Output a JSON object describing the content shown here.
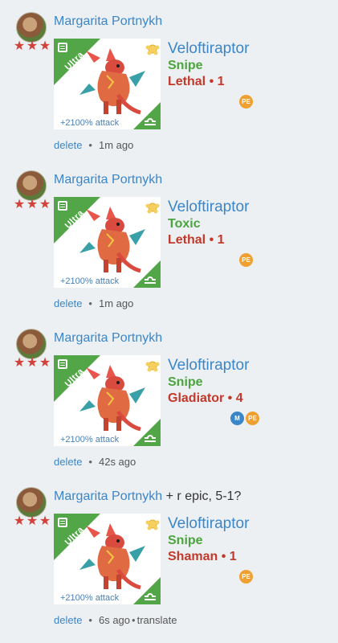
{
  "posts": [
    {
      "author": "Margarita Portnykh",
      "message": "",
      "rating_stars": 3,
      "card": {
        "rarity": "Ultra",
        "attack": "+2100% attack",
        "element": "libra-icon"
      },
      "dragon": {
        "name": "Veloftiraptor",
        "trait": "Snipe",
        "role": "Lethal • 1"
      },
      "badges": [
        {
          "label": "PE",
          "color": "#f0a030"
        }
      ],
      "actions": {
        "delete": "delete",
        "separator": "•",
        "time": "1m ago",
        "translate": ""
      }
    },
    {
      "author": "Margarita Portnykh",
      "message": "",
      "rating_stars": 3,
      "card": {
        "rarity": "Ultra",
        "attack": "+2100% attack",
        "element": "libra-icon"
      },
      "dragon": {
        "name": "Veloftiraptor",
        "trait": "Toxic",
        "role": "Lethal • 1"
      },
      "badges": [
        {
          "label": "PE",
          "color": "#f0a030"
        }
      ],
      "actions": {
        "delete": "delete",
        "separator": "•",
        "time": "1m ago",
        "translate": ""
      }
    },
    {
      "author": "Margarita Portnykh",
      "message": "",
      "rating_stars": 3,
      "card": {
        "rarity": "Ultra",
        "attack": "+2100% attack",
        "element": "libra-icon"
      },
      "dragon": {
        "name": "Veloftiraptor",
        "trait": "Snipe",
        "role": "Gladiator • 4"
      },
      "badges": [
        {
          "label": "M",
          "color": "#3a86c8"
        },
        {
          "label": "PE",
          "color": "#f0a030"
        }
      ],
      "actions": {
        "delete": "delete",
        "separator": "•",
        "time": "42s ago",
        "translate": ""
      }
    },
    {
      "author": "Margarita Portnykh",
      "message": "+ r epic, 5-1?",
      "rating_stars": 3,
      "card": {
        "rarity": "Ultra",
        "attack": "+2100% attack",
        "element": "libra-icon"
      },
      "dragon": {
        "name": "Veloftiraptor",
        "trait": "Snipe",
        "role": "Shaman • 1"
      },
      "badges": [
        {
          "label": "PE",
          "color": "#f0a030"
        }
      ],
      "actions": {
        "delete": "delete",
        "separator": "•",
        "time": "6s ago",
        "translate": "translate"
      }
    }
  ],
  "colors": {
    "link": "#3a86c8",
    "trait": "#4ca43f",
    "role": "#c0392b",
    "rarity_ribbon": "#52a647",
    "stars": "#d2413a"
  }
}
